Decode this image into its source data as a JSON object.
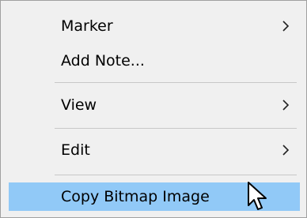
{
  "context_menu": {
    "items": [
      {
        "label": "Marker",
        "has_submenu": true
      },
      {
        "label": "Add Note...",
        "has_submenu": false
      },
      {
        "label": "View",
        "has_submenu": true
      },
      {
        "label": "Edit",
        "has_submenu": true
      },
      {
        "label": "Copy Bitmap Image",
        "has_submenu": false,
        "highlighted": true
      }
    ],
    "highlight_color": "#91c9f7",
    "submenu_icon": "chevron-right-icon",
    "cursor_icon": "mouse-pointer-icon"
  }
}
